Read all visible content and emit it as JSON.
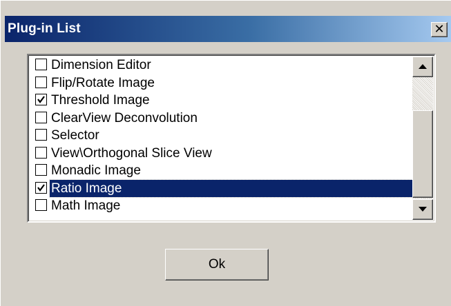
{
  "window": {
    "title": "Plug-in List",
    "close_glyph": "✕"
  },
  "plugins": [
    {
      "label": "Dimension Editor",
      "checked": false,
      "selected": false
    },
    {
      "label": "Flip/Rotate Image",
      "checked": false,
      "selected": false
    },
    {
      "label": "Threshold Image",
      "checked": true,
      "selected": false
    },
    {
      "label": "ClearView Deconvolution",
      "checked": false,
      "selected": false
    },
    {
      "label": "Selector",
      "checked": false,
      "selected": false
    },
    {
      "label": "View\\Orthogonal Slice View",
      "checked": false,
      "selected": false
    },
    {
      "label": "Monadic Image",
      "checked": false,
      "selected": false
    },
    {
      "label": "Ratio Image",
      "checked": true,
      "selected": true
    },
    {
      "label": "Math Image",
      "checked": false,
      "selected": false
    }
  ],
  "ok_label": "Ok",
  "colors": {
    "title_bar_start": "#0a246a",
    "title_bar_end": "#a6caf0",
    "selection": "#0a246a",
    "face": "#d4d0c8"
  },
  "icons": {
    "close": "close-icon",
    "scroll_up": "arrow-up-icon",
    "scroll_down": "arrow-down-icon",
    "check": "checkmark-icon"
  }
}
